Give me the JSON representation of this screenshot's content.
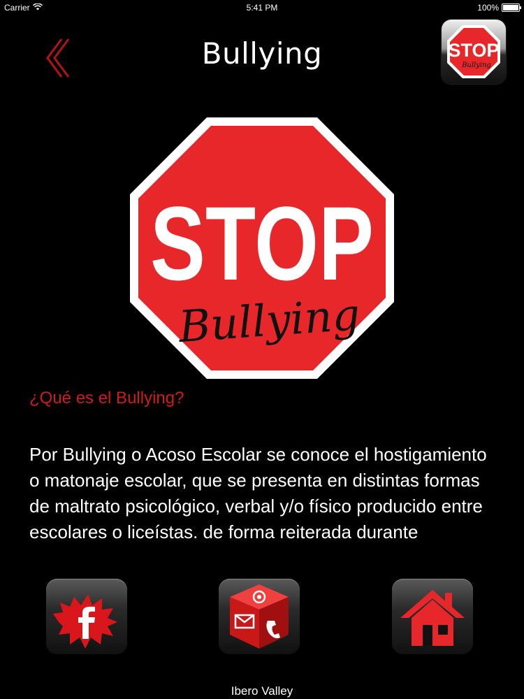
{
  "status_bar": {
    "carrier": "Carrier",
    "time": "5:41 PM",
    "battery": "100%"
  },
  "header": {
    "title": "Bullying",
    "back_icon": "double-chevron-left-icon",
    "stop_button_icon": "stop-bullying-sign-icon"
  },
  "hero": {
    "sign_text": "STOP",
    "sign_script": "Bullying"
  },
  "content": {
    "heading": "¿Qué es el Bullying?",
    "body": "Por Bullying o Acoso Escolar se conoce el hostigamiento o matonaje escolar, que se presenta en distintas formas de maltrato psicológico, verbal y/o físico producido entre escolares o liceístas. de forma reiterada durante"
  },
  "bottom_bar": {
    "facebook_icon": "facebook-icon",
    "contact_icon": "contact-cube-icon",
    "home_icon": "home-icon"
  },
  "footer": {
    "text": "Ibero Valley"
  },
  "colors": {
    "background": "#000000",
    "accent_red": "#d11a1a",
    "sign_red": "#e8272b"
  }
}
